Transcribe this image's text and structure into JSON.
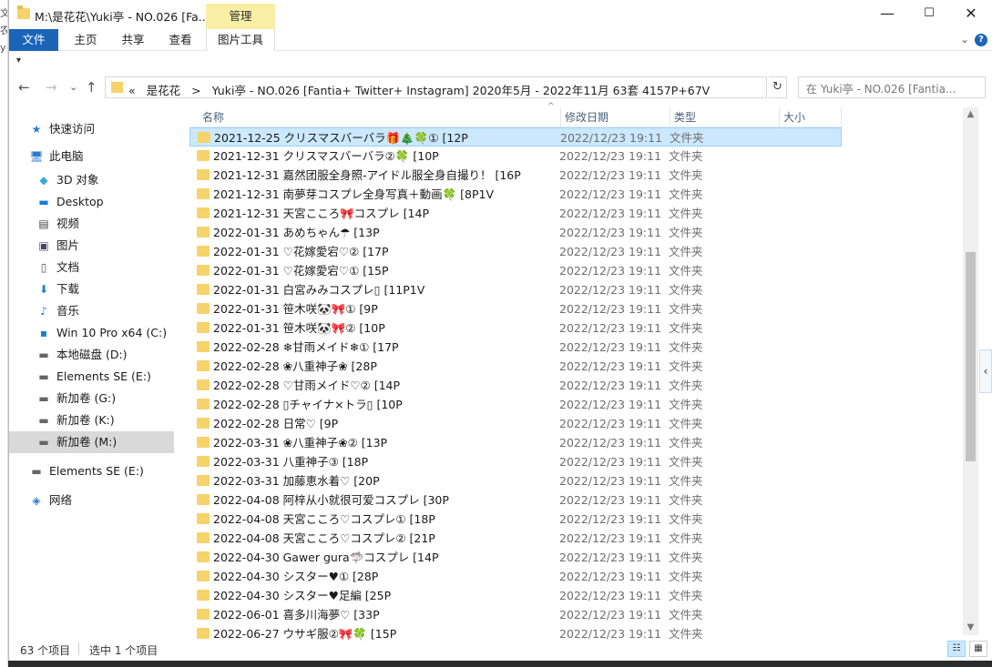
{
  "window": {
    "title": "M:\\是花花\\Yuki亭 - NO.026 [Fa...",
    "manage_tab": "管理",
    "controls": {
      "minimize": "—",
      "maximize": "☐",
      "close": "✕"
    }
  },
  "desktop_edge": [
    "文",
    "农",
    "y"
  ],
  "ribbon": {
    "tabs": [
      "文件",
      "主页",
      "共享",
      "查看",
      "图片工具"
    ],
    "chevron": "⌄",
    "help": "?"
  },
  "quick_access": {
    "dropdown": "▾"
  },
  "nav_buttons": {
    "back": "←",
    "forward": "→",
    "recent": "⌄",
    "up": "↑"
  },
  "address": {
    "prefix": "«",
    "segments": [
      "是花花",
      ">",
      "Yuki亭 - NO.026 [Fantia+ Twitter+ Instagram]  2020年5月 - 2022年11月 63套  4157P+67V"
    ],
    "dropdown": "⌄",
    "refresh": "↻"
  },
  "search": {
    "placeholder": "在 Yuki亭 - NO.026 [Fantia..."
  },
  "nav_pane": [
    {
      "label": "快速访问",
      "icon": "star-icon",
      "glyph": "★",
      "color": "#2a7ad5"
    },
    {
      "label": "此电脑",
      "icon": "pc-icon",
      "glyph": "🖥",
      "color": "#2a7ad5"
    },
    {
      "label": "3D 对象",
      "icon": "cube-icon",
      "glyph": "◆",
      "color": "#3aa6dd"
    },
    {
      "label": "Desktop",
      "icon": "desktop-icon",
      "glyph": "▬",
      "color": "#1a7fd4"
    },
    {
      "label": "视频",
      "icon": "video-icon",
      "glyph": "▤",
      "color": "#444"
    },
    {
      "label": "图片",
      "icon": "picture-icon",
      "glyph": "▣",
      "color": "#446"
    },
    {
      "label": "文档",
      "icon": "document-icon",
      "glyph": "▯",
      "color": "#555"
    },
    {
      "label": "下载",
      "icon": "download-icon",
      "glyph": "⬇",
      "color": "#1a7fd4"
    },
    {
      "label": "音乐",
      "icon": "music-icon",
      "glyph": "♪",
      "color": "#1a7fd4"
    },
    {
      "label": "Win 10 Pro x64 (C:)",
      "icon": "windows-drive-icon",
      "glyph": "▪",
      "color": "#1a7fd4"
    },
    {
      "label": "本地磁盘 (D:)",
      "icon": "drive-icon",
      "glyph": "▬",
      "color": "#666"
    },
    {
      "label": "Elements SE (E:)",
      "icon": "drive-icon",
      "glyph": "▬",
      "color": "#666"
    },
    {
      "label": "新加卷 (G:)",
      "icon": "drive-icon",
      "glyph": "▬",
      "color": "#666"
    },
    {
      "label": "新加卷 (K:)",
      "icon": "drive-icon",
      "glyph": "▬",
      "color": "#666"
    },
    {
      "label": "新加卷 (M:)",
      "icon": "drive-icon",
      "glyph": "▬",
      "color": "#666",
      "selected": true
    },
    {
      "label": "Elements SE (E:)",
      "icon": "drive-icon",
      "glyph": "▬",
      "color": "#666"
    },
    {
      "label": "网络",
      "icon": "network-icon",
      "glyph": "◈",
      "color": "#2a7ad5"
    }
  ],
  "columns": {
    "name": "名称",
    "modified": "修改日期",
    "type": "类型",
    "size": "大小",
    "sort_indicator": "^"
  },
  "files": [
    {
      "name": "2021-12-25 クリスマスバーバラ🎁🎄🍀① [12P",
      "date": "2022/12/23 19:11",
      "type": "文件夹",
      "selected": true
    },
    {
      "name": "2021-12-31 クリスマスバーバラ②🍀 [10P",
      "date": "2022/12/23 19:11",
      "type": "文件夹"
    },
    {
      "name": "2021-12-31 嘉然团服全身照-アイドル服全身自撮り！ [16P",
      "date": "2022/12/23 19:11",
      "type": "文件夹"
    },
    {
      "name": "2021-12-31 南夢芽コスプレ全身写真＋動画🍀 [8P1V",
      "date": "2022/12/23 19:11",
      "type": "文件夹"
    },
    {
      "name": "2021-12-31 天宮こころ🎀コスプレ [14P",
      "date": "2022/12/23 19:11",
      "type": "文件夹"
    },
    {
      "name": "2022-01-31 あめちゃん☂ [13P",
      "date": "2022/12/23 19:11",
      "type": "文件夹"
    },
    {
      "name": "2022-01-31 ♡花嫁愛宕♡② [17P",
      "date": "2022/12/23 19:11",
      "type": "文件夹"
    },
    {
      "name": "2022-01-31 ♡花嫁愛宕♡① [15P",
      "date": "2022/12/23 19:11",
      "type": "文件夹"
    },
    {
      "name": "2022-01-31 白宮みみコスプレ▯ [11P1V",
      "date": "2022/12/23 19:11",
      "type": "文件夹"
    },
    {
      "name": "2022-01-31 笹木咲🐼🎀① [9P",
      "date": "2022/12/23 19:11",
      "type": "文件夹"
    },
    {
      "name": "2022-01-31 笹木咲🐼🎀② [10P",
      "date": "2022/12/23 19:11",
      "type": "文件夹"
    },
    {
      "name": "2022-02-28 ❄甘雨メイド❄① [17P",
      "date": "2022/12/23 19:11",
      "type": "文件夹"
    },
    {
      "name": "2022-02-28 ❀八重神子❀ [28P",
      "date": "2022/12/23 19:11",
      "type": "文件夹"
    },
    {
      "name": "2022-02-28 ♡甘雨メイド♡② [14P",
      "date": "2022/12/23 19:11",
      "type": "文件夹"
    },
    {
      "name": "2022-02-28 ▯チャイナ×トラ▯ [10P",
      "date": "2022/12/23 19:11",
      "type": "文件夹"
    },
    {
      "name": "2022-02-28 日常♡ [9P",
      "date": "2022/12/23 19:11",
      "type": "文件夹"
    },
    {
      "name": "2022-03-31 ❀八重神子❀② [13P",
      "date": "2022/12/23 19:11",
      "type": "文件夹"
    },
    {
      "name": "2022-03-31 八重神子③ [18P",
      "date": "2022/12/23 19:11",
      "type": "文件夹"
    },
    {
      "name": "2022-03-31 加藤恵水着♡ [20P",
      "date": "2022/12/23 19:11",
      "type": "文件夹"
    },
    {
      "name": "2022-04-08 阿梓从小就很可爱コスプレ [30P",
      "date": "2022/12/23 19:11",
      "type": "文件夹"
    },
    {
      "name": "2022-04-08 天宮こころ♡コスプレ① [18P",
      "date": "2022/12/23 19:11",
      "type": "文件夹"
    },
    {
      "name": "2022-04-08 天宮こころ♡コスプレ② [21P",
      "date": "2022/12/23 19:11",
      "type": "文件夹"
    },
    {
      "name": "2022-04-30 Gawer gura🦈コスプレ [14P",
      "date": "2022/12/23 19:11",
      "type": "文件夹"
    },
    {
      "name": "2022-04-30 シスター♥① [28P",
      "date": "2022/12/23 19:11",
      "type": "文件夹"
    },
    {
      "name": "2022-04-30 シスター♥足編 [25P",
      "date": "2022/12/23 19:11",
      "type": "文件夹"
    },
    {
      "name": "2022-06-01 喜多川海夢♡ [33P",
      "date": "2022/12/23 19:11",
      "type": "文件夹"
    },
    {
      "name": "2022-06-27 ウサギ服②🎀🍀 [15P",
      "date": "2022/12/23 19:11",
      "type": "文件夹"
    }
  ],
  "scrollbar": {
    "up": "▲",
    "down": "▼",
    "position_fraction": 0.45
  },
  "side_collapse": "‹",
  "status": {
    "count": "63 个项目",
    "selection": "选中 1 个项目"
  },
  "view_buttons": {
    "details": "☷",
    "large_icons": "▦"
  }
}
